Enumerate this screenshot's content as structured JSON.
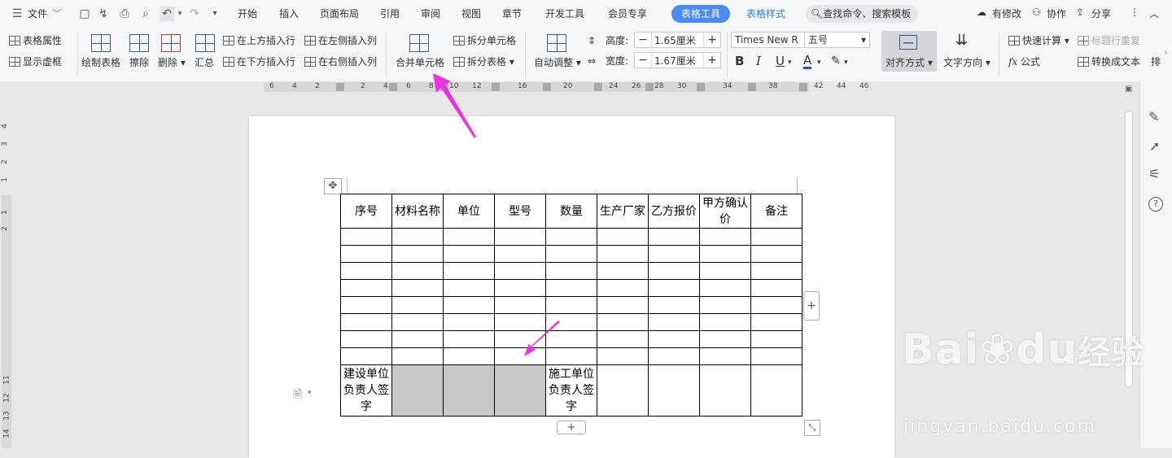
{
  "menubar": {
    "file": "文件",
    "tabs": [
      "开始",
      "插入",
      "页面布局",
      "引用",
      "审阅",
      "视图",
      "章节",
      "开发工具",
      "会员专享"
    ],
    "active_tab": "表格工具",
    "style_tab": "表格样式",
    "search_placeholder": "查找命令、搜索模板",
    "has_changes": "有修改",
    "collaborate": "协作",
    "share": "分享"
  },
  "ribbon": {
    "table_props": "表格属性",
    "show_gridlines": "显示虚框",
    "draw_table": "绘制表格",
    "erase": "擦除",
    "delete": "删除",
    "summary": "汇总",
    "insert_above": "在上方插入行",
    "insert_below": "在下方插入行",
    "insert_left": "在左侧插入列",
    "insert_right": "在右侧插入列",
    "merge_cells": "合并单元格",
    "split_cells": "拆分单元格",
    "split_table": "拆分表格",
    "auto_adjust": "自动调整",
    "height_label": "高度:",
    "height_value": "1.65厘米",
    "width_label": "宽度:",
    "width_value": "1.67厘米",
    "font_name": "Times New R",
    "font_size": "五号",
    "align": "对齐方式",
    "text_direction": "文字方向",
    "quick_calc": "快速计算",
    "header_repeat": "标题行重复",
    "formula": "公式",
    "convert_text": "转换成文本",
    "sort": "排"
  },
  "ruler": {
    "h_numbers": [
      "6",
      "4",
      "2",
      "2",
      "4",
      "6",
      "8",
      "10",
      "12",
      "14",
      "16",
      "18",
      "20",
      "22",
      "24",
      "26",
      "28",
      "30",
      "32",
      "34",
      "36",
      "38",
      "40",
      "42",
      "44",
      "46"
    ],
    "v_numbers": [
      "4",
      "3",
      "2",
      "1",
      "1",
      "2",
      "11",
      "12",
      "13",
      "14"
    ]
  },
  "table": {
    "headers": [
      "序号",
      "材料名称",
      "单位",
      "型号",
      "数量",
      "生产厂家",
      "乙方报价",
      "甲方确认价",
      "备注"
    ],
    "empty_rows": 8,
    "sign_left": "建设单位负责人签字",
    "sign_right": "施工单位负责人签字"
  },
  "watermark": {
    "brand": "Bai",
    "brand2": "du",
    "brand_cn": "经验",
    "url": "jingyan.baidu.com"
  },
  "colors": {
    "accent": "#4a8af4",
    "arrow": "#e834e0",
    "merged_gray": "#c8c8c8"
  }
}
